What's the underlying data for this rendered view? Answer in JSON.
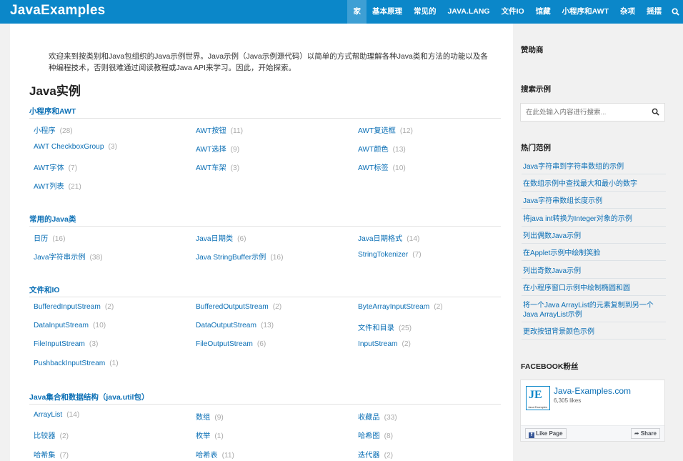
{
  "brand": "JavaExamples",
  "nav": {
    "items": [
      "家",
      "基本原理",
      "常见的",
      "JAVA.LANG",
      "文件IO",
      "馆藏",
      "小程序和AWT",
      "杂项",
      "摇摆"
    ],
    "active_index": 0
  },
  "intro": "欢迎来到按类别和Java包组织的Java示例世界。Java示例（Java示例源代码）以简单的方式帮助理解各种Java类和方法的功能以及各种编程技术，否则很难通过阅读教程或Java API来学习。因此，开始探索。",
  "heading": "Java实例",
  "categories": [
    {
      "title": "小程序和AWT",
      "links": [
        {
          "label": "小程序",
          "count": "(28)"
        },
        {
          "label": "AWT按钮",
          "count": "(11)"
        },
        {
          "label": "AWT复选框",
          "count": "(12)"
        },
        {
          "label": "AWT CheckboxGroup",
          "count": "(3)"
        },
        {
          "label": "AWT选择",
          "count": "(9)"
        },
        {
          "label": "AWT颜色",
          "count": "(13)"
        },
        {
          "label": "AWT字体",
          "count": "(7)"
        },
        {
          "label": "AWT车架",
          "count": "(3)"
        },
        {
          "label": "AWT标签",
          "count": "(10)"
        },
        {
          "label": "AWT列表",
          "count": "(21)"
        }
      ]
    },
    {
      "title": "常用的Java类",
      "links": [
        {
          "label": "日历",
          "count": "(16)"
        },
        {
          "label": "Java日期类",
          "count": "(6)"
        },
        {
          "label": "Java日期格式",
          "count": "(14)"
        },
        {
          "label": "Java字符串示例",
          "count": "(38)"
        },
        {
          "label": "Java StringBuffer示例",
          "count": "(16)"
        },
        {
          "label": "StringTokenizer",
          "count": "(7)"
        }
      ]
    },
    {
      "title": "文件和IO",
      "links": [
        {
          "label": "BufferedInputStream",
          "count": "(2)"
        },
        {
          "label": "BufferedOutputStream",
          "count": "(2)"
        },
        {
          "label": "ByteArrayInputStream",
          "count": "(2)"
        },
        {
          "label": "DataInputStream",
          "count": "(10)"
        },
        {
          "label": "DataOutputStream",
          "count": "(13)"
        },
        {
          "label": "文件和目录",
          "count": "(25)"
        },
        {
          "label": "FileInputStream",
          "count": "(3)"
        },
        {
          "label": "FileOutputStream",
          "count": "(6)"
        },
        {
          "label": "InputStream",
          "count": "(2)"
        },
        {
          "label": "PushbackInputStream",
          "count": "(1)"
        }
      ]
    },
    {
      "title": "Java集合和数据结构（java.util包）",
      "links": [
        {
          "label": "ArrayList",
          "count": "(14)"
        },
        {
          "label": "数组",
          "count": "(9)"
        },
        {
          "label": "收藏品",
          "count": "(33)"
        },
        {
          "label": "比较器",
          "count": "(2)"
        },
        {
          "label": "枚举",
          "count": "(1)"
        },
        {
          "label": "哈希图",
          "count": "(8)"
        },
        {
          "label": "哈希集",
          "count": "(7)"
        },
        {
          "label": "哈希表",
          "count": "(11)"
        },
        {
          "label": "迭代器",
          "count": "(2)"
        }
      ]
    }
  ],
  "sidebar": {
    "sponsors_title": "赞助商",
    "search_title": "搜索示例",
    "search_placeholder": "在此处输入内容进行搜索...",
    "hot_title": "热门范例",
    "hot_links": [
      "Java字符串到字符串数组的示例",
      "在数组示例中查找最大和最小的数字",
      "Java字符串数组长度示例",
      "将java int转换为Integer对象的示例",
      "列出偶数Java示例",
      "在Applet示例中绘制笑脸",
      "列出奇数Java示例",
      "在小程序窗口示例中绘制椭圆和圆",
      "将一个Java ArrayList的元素复制到另一个Java ArrayList示例",
      "更改按钮背景颜色示例"
    ],
    "fb_title": "FACEBOOK粉丝",
    "fb_page_name": "Java-Examples.com",
    "fb_likes": "6,305 likes",
    "fb_logo_text": "JE",
    "fb_logo_small": "Java Examples",
    "fb_like_label": "Like Page",
    "fb_share_label": "Share"
  },
  "colors": {
    "accent": "#0b87c9",
    "link": "#0b6fb5",
    "count": "#aaaaaa"
  }
}
